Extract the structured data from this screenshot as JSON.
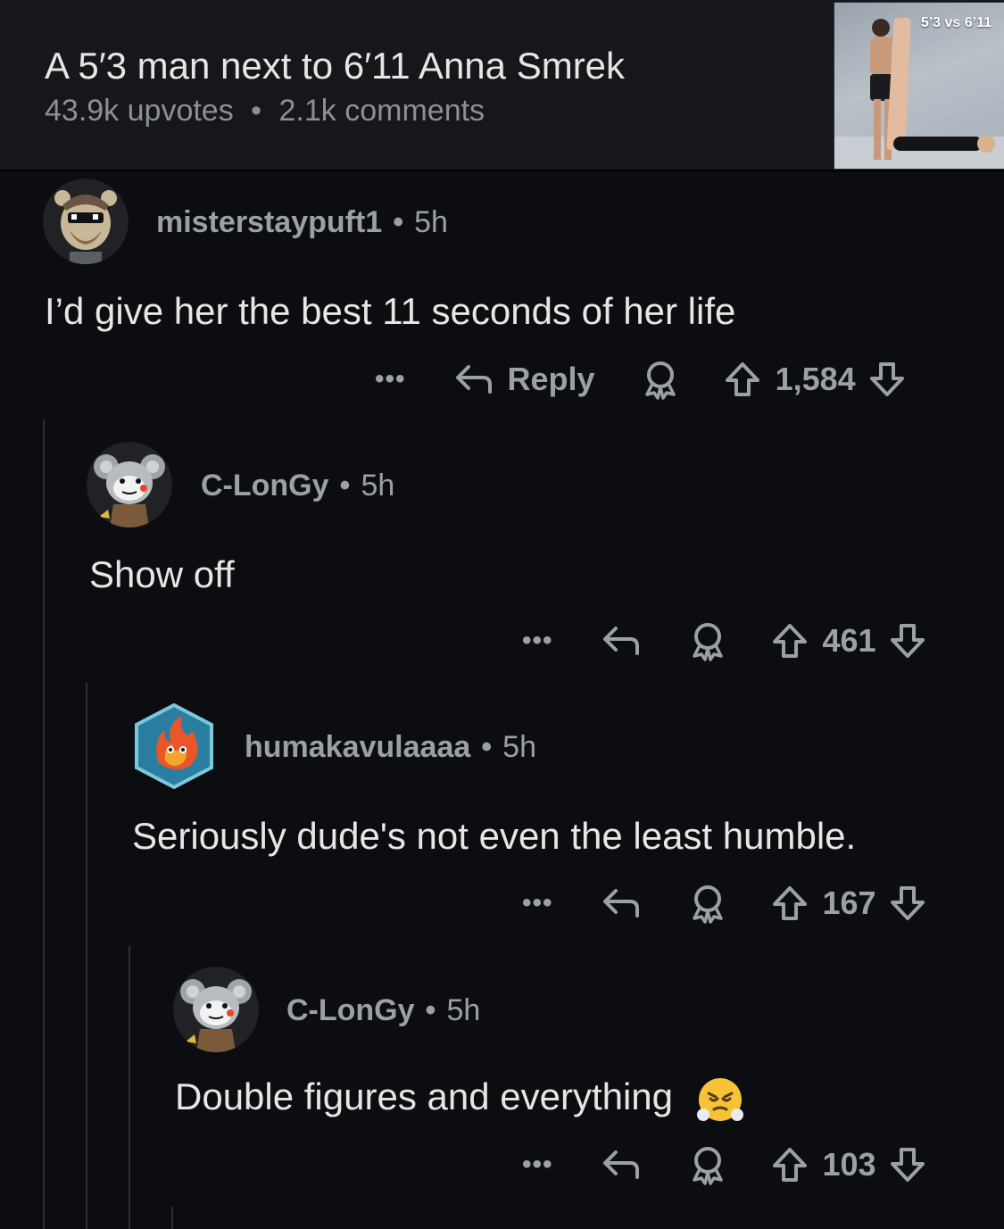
{
  "post": {
    "title": "A 5′3 man next to 6′11 Anna Smrek",
    "upvotes": "43.9k upvotes",
    "separator": "•",
    "comments": "2.1k comments",
    "thumbnail_label": "5’3 vs 6’11"
  },
  "comments": [
    {
      "username": "misterstaypuft1",
      "age": "5h",
      "text": "I’d give her the best 11 seconds of her life",
      "more": "•••",
      "reply_label": "Reply",
      "score": "1,584",
      "avatar": "bear-with-sunglasses-avatar"
    },
    {
      "username": "C-LonGy",
      "age": "5h",
      "text": "Show off",
      "more": "•••",
      "score": "461",
      "avatar": "koala-avatar"
    },
    {
      "username": "humakavulaaaa",
      "age": "5h",
      "text": "Seriously dude's not even the least humble.",
      "more": "•••",
      "score": "167",
      "avatar": "fire-creature-avatar"
    },
    {
      "username": "C-LonGy",
      "age": "5h",
      "text": "Double figures and everything",
      "emoji": "face-with-steam-from-nose-emoji",
      "more": "•••",
      "score": "103",
      "avatar": "koala-avatar"
    }
  ],
  "colors": {
    "background": "#0b0d11",
    "header": "#15171b",
    "muted": "#9aa0a6",
    "text": "#e6e6e6"
  }
}
